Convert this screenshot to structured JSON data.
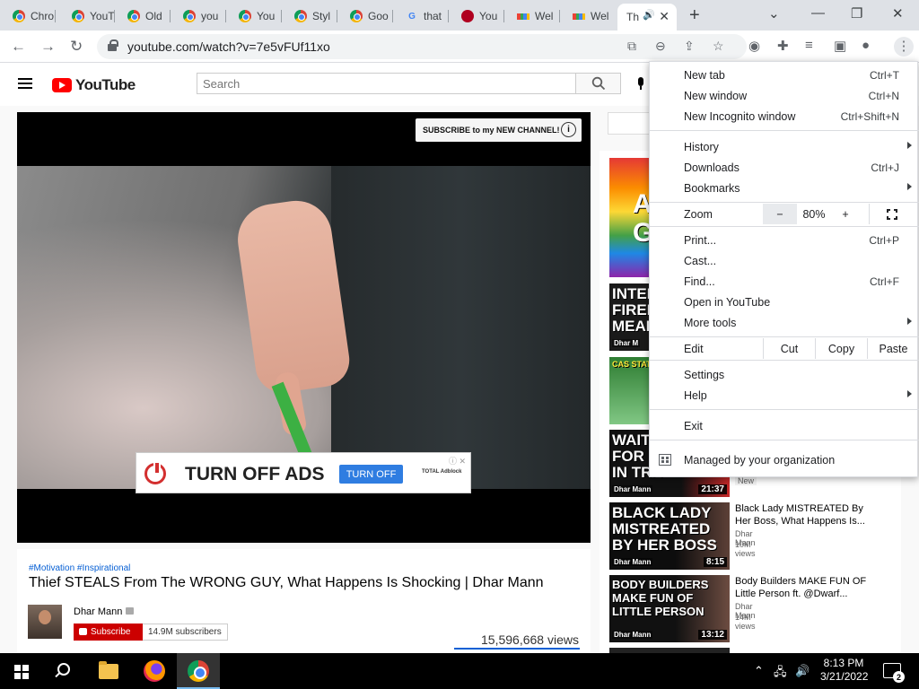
{
  "browser": {
    "tabs": [
      {
        "label": "Chro",
        "favicon": "chrome-icon"
      },
      {
        "label": "YouT",
        "favicon": "chrome-icon"
      },
      {
        "label": "Old",
        "favicon": "chrome-icon"
      },
      {
        "label": "you",
        "favicon": "chrome-icon"
      },
      {
        "label": "You",
        "favicon": "chrome-icon"
      },
      {
        "label": "Styl",
        "favicon": "chrome-icon"
      },
      {
        "label": "Goo",
        "favicon": "chrome-icon"
      },
      {
        "label": "that",
        "favicon": "google-icon"
      },
      {
        "label": "You",
        "favicon": "red-circle-icon"
      },
      {
        "label": "Wel",
        "favicon": "grid-icon"
      },
      {
        "label": "Wel",
        "favicon": "grid-icon"
      },
      {
        "label": "Th",
        "favicon": "none",
        "active": true
      }
    ],
    "url": "youtube.com/watch?v=7e5vFUf11xo"
  },
  "youtube": {
    "logo_text": "YouTube",
    "search_placeholder": "Search",
    "player": {
      "subscribe_card": "SUBSCRIBE to my NEW CHANNEL!",
      "ad": {
        "headline": "TURN OFF ADS",
        "button": "TURN OFF",
        "brand": "TOTAL Adblock"
      }
    },
    "video": {
      "hashtags": "#Motivation #Inspirational",
      "title": "Thief STEALS From The WRONG GUY, What Happens Is Shocking | Dhar Mann",
      "channel": "Dhar Mann",
      "subscribe_label": "Subscribe",
      "subscribers": "14.9M subscribers",
      "views": "15,596,668 views"
    },
    "recommendations": [
      {
        "thumb_text": "A\nG",
        "title": "",
        "channel": "",
        "views": "",
        "duration": ""
      },
      {
        "thumb_text": "INTER\nFIRED\nMEAN",
        "tag": "Dhar M",
        "title": "",
        "channel": "",
        "views": "",
        "duration": ""
      },
      {
        "thumb_text": "CAS STATIO",
        "title": "",
        "channel": "",
        "views": "",
        "duration": ""
      },
      {
        "thumb_text": "WAITRESS\nFOR LI\nIN TRA",
        "tag": "Dhar Mann",
        "title": "",
        "channel": "",
        "views": "",
        "duration": "21:37",
        "badge": "New"
      },
      {
        "thumb_text": "BLACK LADY\nMISTREATED\nBY HER BOSS",
        "tag": "Dhar Mann",
        "title": "Black Lady MISTREATED By Her Boss, What Happens Is...",
        "channel": "Dhar Mann",
        "views": "10M views",
        "duration": "8:15"
      },
      {
        "thumb_text": "BODY BUILDERS\nMAKE FUN OF\nLITTLE PERSON",
        "tag": "Dhar Mann",
        "title": "Body Builders MAKE FUN OF Little Person ft. @Dwarf...",
        "channel": "Dhar Mann",
        "views": "14M views",
        "duration": "13:12"
      }
    ]
  },
  "menu": {
    "items": [
      {
        "label": "New tab",
        "shortcut": "Ctrl+T"
      },
      {
        "label": "New window",
        "shortcut": "Ctrl+N"
      },
      {
        "label": "New Incognito window",
        "shortcut": "Ctrl+Shift+N"
      },
      {
        "label": "History",
        "shortcut": ""
      },
      {
        "label": "Downloads",
        "shortcut": "Ctrl+J"
      },
      {
        "label": "Bookmarks",
        "shortcut": ""
      },
      {
        "label": "Zoom",
        "shortcut": ""
      },
      {
        "label": "Print...",
        "shortcut": "Ctrl+P"
      },
      {
        "label": "Cast...",
        "shortcut": ""
      },
      {
        "label": "Find...",
        "shortcut": "Ctrl+F"
      },
      {
        "label": "Open in YouTube",
        "shortcut": ""
      },
      {
        "label": "More tools",
        "shortcut": ""
      },
      {
        "label": "Edit",
        "shortcut": ""
      },
      {
        "label": "Settings",
        "shortcut": ""
      },
      {
        "label": "Help",
        "shortcut": ""
      },
      {
        "label": "Exit",
        "shortcut": ""
      },
      {
        "label": "Managed by your organization",
        "shortcut": ""
      }
    ],
    "zoom": {
      "minus": "−",
      "value": "80%",
      "plus": "+"
    },
    "edit": {
      "cut": "Cut",
      "copy": "Copy",
      "paste": "Paste"
    }
  },
  "taskbar": {
    "time": "8:13 PM",
    "date": "3/21/2022",
    "notifications": "2"
  }
}
